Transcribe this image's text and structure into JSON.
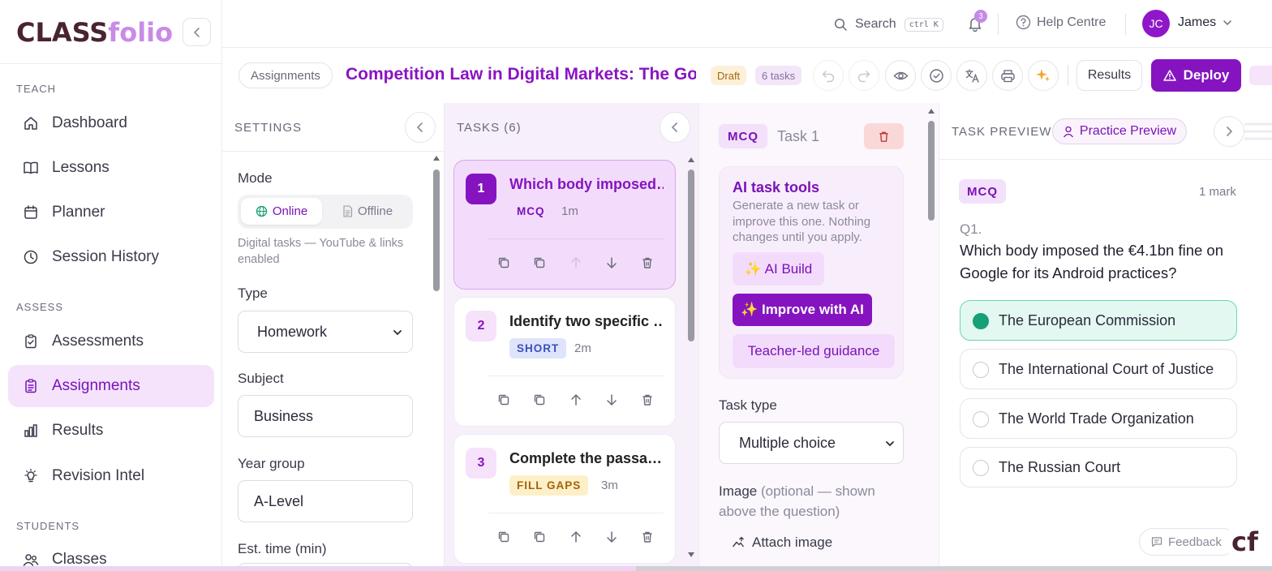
{
  "brand": {
    "logo_part1": "CLASS",
    "logo_part2": "folio",
    "corner_logo": "cf"
  },
  "sidebar": {
    "sections": [
      {
        "label": "TEACH"
      },
      {
        "label": "ASSESS"
      },
      {
        "label": "STUDENTS"
      }
    ],
    "items": [
      {
        "label": "Dashboard",
        "icon": "home-icon"
      },
      {
        "label": "Lessons",
        "icon": "book-icon"
      },
      {
        "label": "Planner",
        "icon": "calendar-icon"
      },
      {
        "label": "Session History",
        "icon": "clock-icon"
      },
      {
        "label": "Assessments",
        "icon": "clipboard-check-icon"
      },
      {
        "label": "Assignments",
        "icon": "clipboard-list-icon",
        "active": true
      },
      {
        "label": "Results",
        "icon": "bar-chart-icon"
      },
      {
        "label": "Revision Intel",
        "icon": "lightbulb-icon"
      },
      {
        "label": "Classes",
        "icon": "users-icon"
      }
    ]
  },
  "topbar": {
    "search_label": "Search",
    "search_shortcut": "ctrl K",
    "notification_count": "3",
    "help_label": "Help Centre",
    "user_initials": "JC",
    "user_name": "James"
  },
  "header": {
    "breadcrumb": "Assignments",
    "title": "Competition Law in Digital Markets: The Go…",
    "status_badge": "Draft",
    "tasks_badge": "6 tasks",
    "results_label": "Results",
    "deploy_label": "Deploy"
  },
  "settings": {
    "title": "SETTINGS",
    "mode_label": "Mode",
    "mode_online": "Online",
    "mode_offline": "Offline",
    "mode_help": "Digital tasks — YouTube & links enabled",
    "type_label": "Type",
    "type_value": "Homework",
    "subject_label": "Subject",
    "subject_value": "Business",
    "year_label": "Year group",
    "year_value": "A-Level",
    "time_label": "Est. time (min)"
  },
  "tasks": {
    "title": "TASKS (6)",
    "items": [
      {
        "num": "1",
        "title": "Which body imposed…",
        "type": "MCQ",
        "time": "1m",
        "type_bg": "#f3dcfb",
        "type_color": "#7a12b8"
      },
      {
        "num": "2",
        "title": "Identify two specific …",
        "type": "SHORT",
        "time": "2m",
        "type_bg": "#dfe4fb",
        "type_color": "#3a4fb8"
      },
      {
        "num": "3",
        "title": "Complete the passa…",
        "type": "FILL GAPS",
        "time": "3m",
        "type_bg": "#fdf0c8",
        "type_color": "#a3620a"
      }
    ]
  },
  "editor": {
    "badge": "MCQ",
    "task_label": "Task 1",
    "ai_title": "AI task tools",
    "ai_desc": "Generate a new task or improve this one. Nothing changes until you apply.",
    "ai_build": "✨ AI Build",
    "ai_improve": "✨ Improve with AI",
    "ai_guidance": "Teacher-led guidance",
    "task_type_label": "Task type",
    "task_type_value": "Multiple choice",
    "image_label": "Image",
    "image_optional": "(optional — shown above the question)",
    "attach_image": "Attach image"
  },
  "preview": {
    "title": "TASK PREVIEW",
    "practice_label": "Practice Preview",
    "badge": "MCQ",
    "marks": "1 mark",
    "qnum": "Q1.",
    "question": "Which body imposed the €4.1bn fine on Google for its Android practices?",
    "options": [
      {
        "text": "The European Commission",
        "correct": true
      },
      {
        "text": "The International Court of Justice",
        "correct": false
      },
      {
        "text": "The World Trade Organization",
        "correct": false
      },
      {
        "text": "The Russian Court",
        "correct": false
      }
    ]
  },
  "feedback_label": "Feedback",
  "colors": {
    "accent": "#8514c0",
    "accent_light": "#f3dcfb",
    "correct": "#16a075"
  }
}
